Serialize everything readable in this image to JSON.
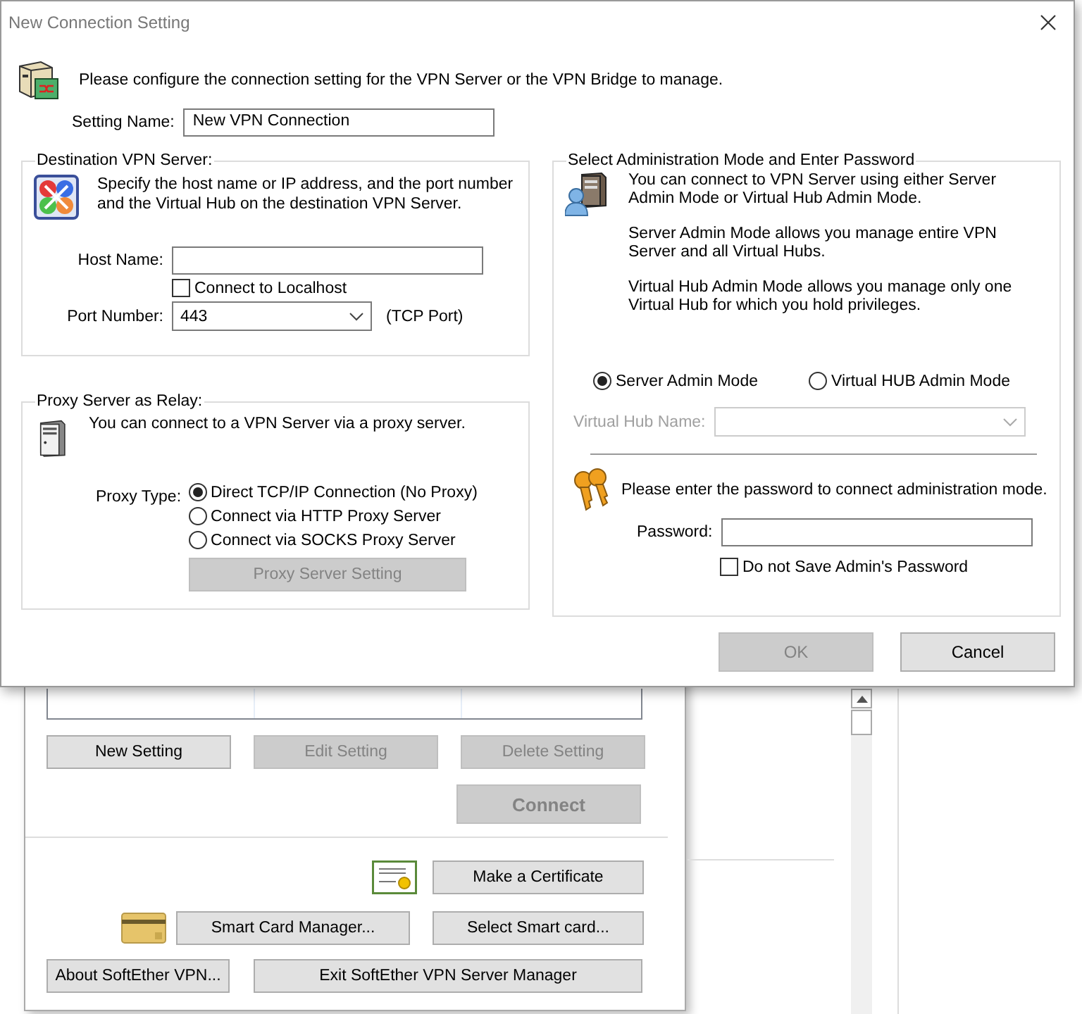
{
  "dialog": {
    "title": "New Connection Setting",
    "intro": "Please configure the connection setting for the VPN Server or the VPN Bridge to manage.",
    "setting_name": {
      "label": "Setting Name:",
      "value": "New VPN Connection"
    },
    "destination": {
      "title": "Destination VPN Server:",
      "description": "Specify the host name or IP address, and the port number and the Virtual Hub on the destination VPN Server.",
      "host": {
        "label": "Host Name:"
      },
      "localhost": {
        "label": "Connect to Localhost",
        "checked": false
      },
      "port": {
        "label": "Port Number:",
        "value": "443",
        "note": "(TCP Port)"
      }
    },
    "proxy": {
      "title": "Proxy Server as Relay:",
      "description": "You can connect to a VPN Server via a proxy server.",
      "type_label": "Proxy Type:",
      "options": [
        {
          "label": "Direct TCP/IP Connection (No Proxy)",
          "selected": true
        },
        {
          "label": "Connect via HTTP Proxy Server",
          "selected": false
        },
        {
          "label": "Connect via SOCKS Proxy Server",
          "selected": false
        }
      ],
      "setting_button": {
        "label": "Proxy Server Setting",
        "disabled": true
      }
    },
    "admin": {
      "title": "Select Administration Mode and Enter Password",
      "paragraphs": [
        "You can connect to VPN Server using either Server Admin Mode or Virtual Hub Admin Mode.",
        "Server Admin Mode allows you manage entire VPN Server and all Virtual Hubs.",
        "Virtual Hub Admin Mode allows you manage only one Virtual Hub for which you hold privileges."
      ],
      "modes": [
        {
          "label": "Server Admin Mode",
          "selected": true
        },
        {
          "label": "Virtual HUB Admin Mode",
          "selected": false
        }
      ],
      "hub_name": {
        "label": "Virtual Hub Name:",
        "disabled": true
      },
      "password_prompt": "Please enter the password to connect administration mode.",
      "password": {
        "label": "Password:"
      },
      "no_save": {
        "label": "Do not Save Admin's Password",
        "checked": false
      }
    },
    "buttons": [
      {
        "label": "OK",
        "disabled": true
      },
      {
        "label": "Cancel",
        "disabled": false
      }
    ]
  },
  "manager": {
    "setting_buttons": [
      {
        "label": "New Setting",
        "disabled": false
      },
      {
        "label": "Edit Setting",
        "disabled": true
      },
      {
        "label": "Delete Setting",
        "disabled": true
      }
    ],
    "connect": {
      "label": "Connect",
      "disabled": true
    },
    "certificate_button": "Make a Certificate",
    "smart_card_buttons": [
      "Smart Card Manager...",
      "Select Smart card..."
    ],
    "bottom_buttons": [
      "About SoftEther VPN...",
      "Exit SoftEther VPN Server Manager"
    ]
  }
}
